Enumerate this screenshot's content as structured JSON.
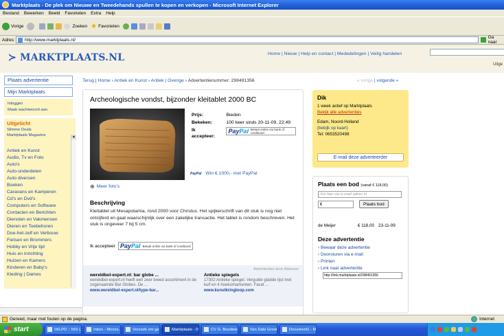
{
  "window": {
    "title": "Marktplaats - De plek om Nieuwe en Tweedehands spullen te kopen en verkopen - Microsoft Internet Explorer"
  },
  "menu": [
    "Bestand",
    "Bewerken",
    "Beeld",
    "Favorieten",
    "Extra",
    "Help"
  ],
  "toolbar": {
    "back": "Vorige",
    "search": "Zoeken",
    "favorites": "Favorieten"
  },
  "address": {
    "label": "Adres",
    "url": "http://www.marktplaats.nl/",
    "go": "Ga naar"
  },
  "site": {
    "logo": "MARKTPLAATS.NL",
    "top_links": "Home | Nieuw | Help en contact | Mededelingen | Veilig handelen",
    "uitgebreid": "Uitge"
  },
  "sidebar": {
    "btn_plaats": "Plaats advertentie",
    "btn_mijn": "Mijn Marktplaats",
    "login": "Inloggen",
    "wachtwoord": "Maak wachtwoord aan",
    "uitgelicht_title": "Uitgelicht",
    "uitgelicht_links": [
      "Slimme Deals",
      "Marktplaats Magazine"
    ],
    "categories": [
      "Antiek en Kunst",
      "Audio, Tv en Foto",
      "Auto's",
      "Auto-onderdelen",
      "Auto diversen",
      "Boeken",
      "Caravans en Kamperen",
      "Cd's en Dvd's",
      "Computers en Software",
      "Contacten en Berichten",
      "Diensten en Vakmensen",
      "Dieren en Toebehoren",
      "Doe-het-zelf en Verbouw",
      "Fietsen en Brommers",
      "Hobby en Vrije tijd",
      "Huis en Inrichting",
      "Huizen en Kamers",
      "Kinderen en Baby's",
      "Kleding | Dames"
    ]
  },
  "breadcrumb": {
    "terug": "Terug",
    "home": "Home",
    "cat1": "Antiek en Kunst",
    "cat2": "Antiek | Overige",
    "nummer": "Advertentienummer: 298491356",
    "vorige": "« vorige",
    "volgende": "volgende »"
  },
  "listing": {
    "title": "Archeologische vondst, bijzonder kleitablet 2000 BC",
    "prijs_label": "Prijs:",
    "prijs_value": "Bieden",
    "bekeken_label": "Bekeken:",
    "bekeken_value": "100 keer sinds 20-11-09, 22:49",
    "accepteer_label": "Ik accepteer:",
    "paypal_text": "Betaal online via bank of creditcard",
    "win_link": "Win € 1000,- met PayPal",
    "meer_fotos": "Meer foto's",
    "beschrijving_title": "Beschrijving",
    "beschrijving": "Kleitablet uit Mesapotamia, rond 2000 voor Christus. Het spijkerschrift van dit stuk is nog niet ontcijferd en gaat waarschijnlijk over een zakelijke transactie. Het tablet is rondom beschreven. Het stuk is ongeveer 7 bij 5 cm.",
    "accepteer2": "Ik accepteer"
  },
  "ads": {
    "label": "Advertenties door Adsense",
    "items": [
      {
        "title": "wereldbol-expert.nl: bar globe ...",
        "text": "wereldbol-expert.nl heeft een zeer breed assortiment in de zogenaamde Bar Globes. De ...",
        "url": "www.wereldbol-expert.nl/type-bar..."
      },
      {
        "title": "Antieke spiegels",
        "text": "17302 Antieke spiegel. Vergulde gladde lijst met kuif en 4 hoekornamenten. Facet ...",
        "url": "www.kunstkringloop.com"
      }
    ]
  },
  "seller": {
    "name": "Dik",
    "active": "1 week actief op Marktplaats",
    "alle": "Bekijk alle advertenties",
    "location": "Edam, Noord-Holland",
    "kaart": "(bekijk op kaart)",
    "tel": "Tel:  0653520498",
    "email_btn": "E-mail deze adverteerder"
  },
  "bod": {
    "title": "Plaats een bod",
    "vanaf": "(vanaf € 118,00)",
    "email_placeholder": "Vul hier uw e-mail adres in",
    "currency": "€",
    "button": "Plaats bod",
    "bidder": "de Meijer",
    "amount": "€ 118,00",
    "date": "23-11-09"
  },
  "deze": {
    "title": "Deze advertentie",
    "actions": [
      "Bewaar deze advertentie",
      "Doorsturen via e-mail",
      "Printen",
      "Link naar advertentie"
    ],
    "link": "http://link.marktplaats.nl/298491356"
  },
  "status": {
    "text": "Gereed, maar met fouten op de pagina.",
    "zone": "Internet"
  },
  "taskbar": {
    "start": "start",
    "tasks": [
      "\\\\KLPD :: NIS (...",
      "Inbox - Micros...",
      "Verzoek om ge...",
      "Marktplaats - D...",
      "CV G. Boudewij...",
      "Van Dale Groot...",
      "Document1 - Mi..."
    ]
  }
}
